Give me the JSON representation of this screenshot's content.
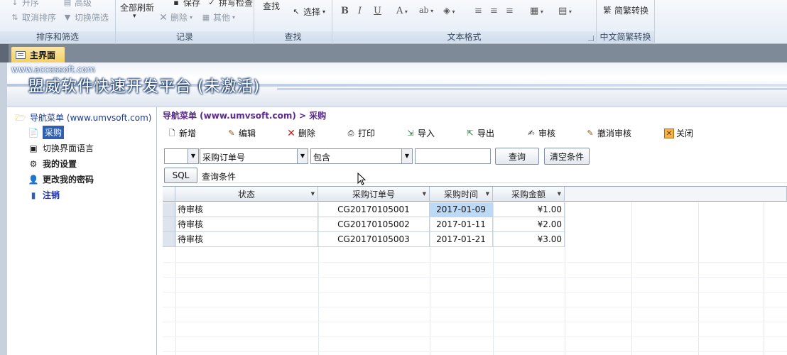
{
  "ribbon": {
    "sort_filter": {
      "asc": "升序",
      "desc": "降序",
      "advanced": "高级",
      "clear_sort": "取消排序",
      "toggle_filter": "切换筛选",
      "group": "排序和筛选"
    },
    "records": {
      "refresh_all": "全部刷新",
      "save": "保存",
      "spell": "拼写检查",
      "delete": "删除",
      "other": "其他",
      "group": "记录"
    },
    "find": {
      "find": "查找",
      "select": "选择",
      "group": "查找"
    },
    "text_format": {
      "group": "文本格式"
    },
    "chinese": {
      "convert": "简繁转换",
      "group": "中文简繁转换"
    }
  },
  "tab": {
    "label": "主界面"
  },
  "banner": {
    "site": "www.accessoft.com",
    "title": "盟威软件快速开发平台 (未激活)"
  },
  "tree": {
    "root": "导航菜单 (www.umvsoft.com)",
    "items": [
      "采购",
      "切换界面语言",
      "我的设置",
      "更改我的密码",
      "注销"
    ]
  },
  "breadcrumb": "导航菜单 (www.umvsoft.com) > 采购",
  "toolbar": {
    "add": "新增",
    "edit": "编辑",
    "delete": "删除",
    "print": "打印",
    "import": "导入",
    "export": "导出",
    "audit": "审核",
    "unaudit": "撤消审核",
    "close": "关闭"
  },
  "filter": {
    "field_value": "采购订单号",
    "operator_value": "包含",
    "search_button": "查询",
    "clear_button": "清空条件",
    "sql_button": "SQL",
    "condition_label": "查询条件"
  },
  "table": {
    "columns": [
      "状态",
      "采购订单号",
      "采购时间",
      "采购金额"
    ],
    "rows": [
      [
        "待审核",
        "CG20170105001",
        "2017-01-09",
        "¥1.00"
      ],
      [
        "待审核",
        "CG20170105002",
        "2017-01-11",
        "¥2.00"
      ],
      [
        "待审核",
        "CG20170105003",
        "2017-01-21",
        "¥3.00"
      ]
    ]
  }
}
